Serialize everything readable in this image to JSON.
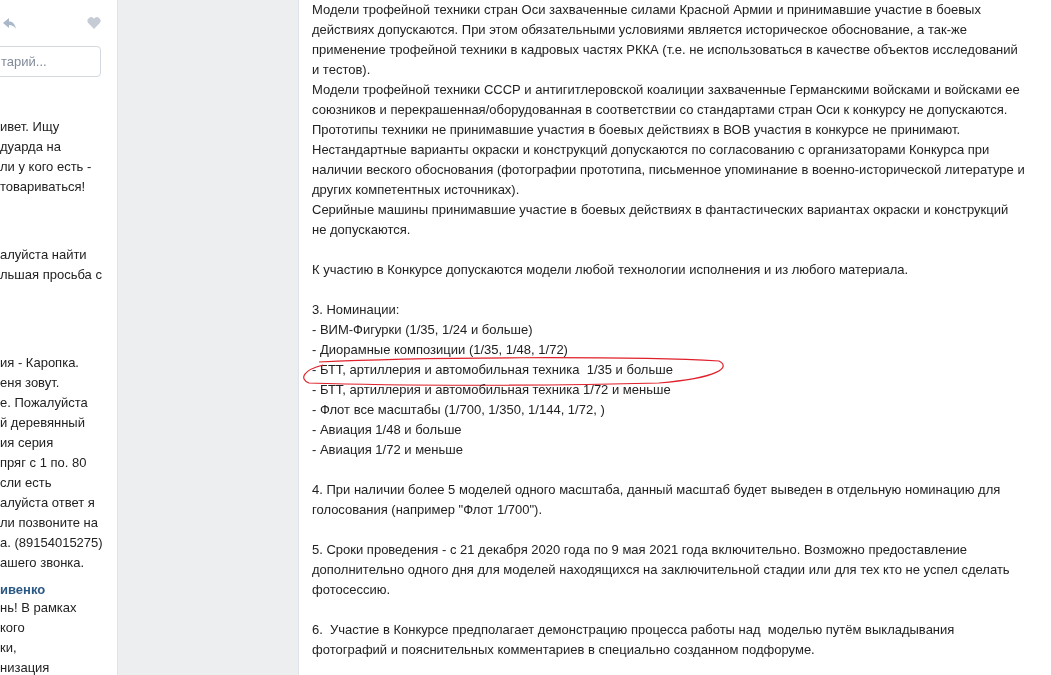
{
  "left_feed": {
    "comment_placeholder": "тарий...",
    "posts": [
      {
        "lines": [
          "ивет. Ищу",
          "дуарда на",
          "ли у кого есть -",
          "товариваться!"
        ]
      },
      {
        "lines": [
          "алуйста найти",
          "льшая просьба с"
        ]
      },
      {
        "lines": [
          "ия - Каропка.",
          "еня зовут.",
          "е. Пожалуйста",
          "й деревянный",
          "ия серия",
          "пряг с 1 по. 80",
          "сли есть",
          "алуйста ответ я",
          "ли позвоните на",
          "а. (89154015275)",
          "ашего звонка."
        ]
      },
      {
        "author": "ивенко",
        "lines": [
          "нь! В рамках",
          "кого",
          "ки,",
          "низация"
        ]
      }
    ]
  },
  "article": {
    "blocks": [
      {
        "kind": "paragraph",
        "lines": [
          "Модели трофейной техники стран Оси захваченные силами Красной Армии и принимавшие участие в боевых",
          "действиях допускаются. При этом обязательными условиями является историческое обоснование, а так-же",
          "применение трофейной техники в кадровых частях РККА (т.е. не использоваться в качестве объектов исследований",
          "и тестов).",
          "Модели трофейной техники СССР и антигитлеровской коалиции захваченные Германскими войсками и войсками ее",
          "союзников и перекрашенная/оборудованная в соответствии со стандартами стран Оси к конкурсу не допускаются.",
          "Прототипы техники не принимавшие участия в боевых действиях в ВОВ участия в конкурсе не принимают.",
          "Нестандартные варианты окраски и конструкций допускаются по согласованию с организаторами Конкурса при",
          "наличии веского обоснования (фотографии прототипа, письменное упоминание в военно-исторической литературе и",
          "других компетентных источниках).",
          "Серийные машины принимавшие участие в боевых действиях в фантастических вариантах окраски и конструкций",
          "не допускаются."
        ]
      },
      {
        "kind": "paragraph",
        "lines": [
          "К участию в Конкурсе допускаются модели любой технологии исполнения и из любого материала."
        ]
      },
      {
        "kind": "list",
        "heading": "3. Номинации:",
        "items": [
          {
            "text": "- ВИМ-Фигурки (1/35, 1/24 и больше)",
            "circled": false
          },
          {
            "text": "- Диорамные композиции (1/35, 1/48, 1/72)",
            "circled": false
          },
          {
            "text": "- БТТ, артиллерия и автомобильная техника  1/35 и больше",
            "circled": true
          },
          {
            "text": "- БТТ, артиллерия и автомобильная техника 1/72 и меньше",
            "circled": false
          },
          {
            "text": "- Флот все масштабы (1/700, 1/350, 1/144, 1/72, )",
            "circled": false
          },
          {
            "text": "- Авиация 1/48 и больше",
            "circled": false
          },
          {
            "text": "- Авиация 1/72 и меньше",
            "circled": false
          }
        ]
      },
      {
        "kind": "paragraph",
        "lines": [
          "4. При наличии более 5 моделей одного масштаба, данный масштаб будет выведен в отдельную номинацию для",
          "голосования (например \"Флот 1/700\")."
        ]
      },
      {
        "kind": "paragraph",
        "lines": [
          "5. Сроки проведения - с 21 декабря 2020 года по 9 мая 2021 года включительно. Возможно предоставление",
          "дополнительно одного дня для моделей находящихся на заключительной стадии или для тех кто не успел сделать",
          "фотосессию."
        ]
      },
      {
        "kind": "paragraph",
        "lines": [
          "6.  Участие в Конкурсе предполагает демонстрацию процесса работы над  моделью путём выкладывания",
          "фотографий и пояснительных комментариев в специально созданном подфоруме."
        ]
      }
    ]
  }
}
